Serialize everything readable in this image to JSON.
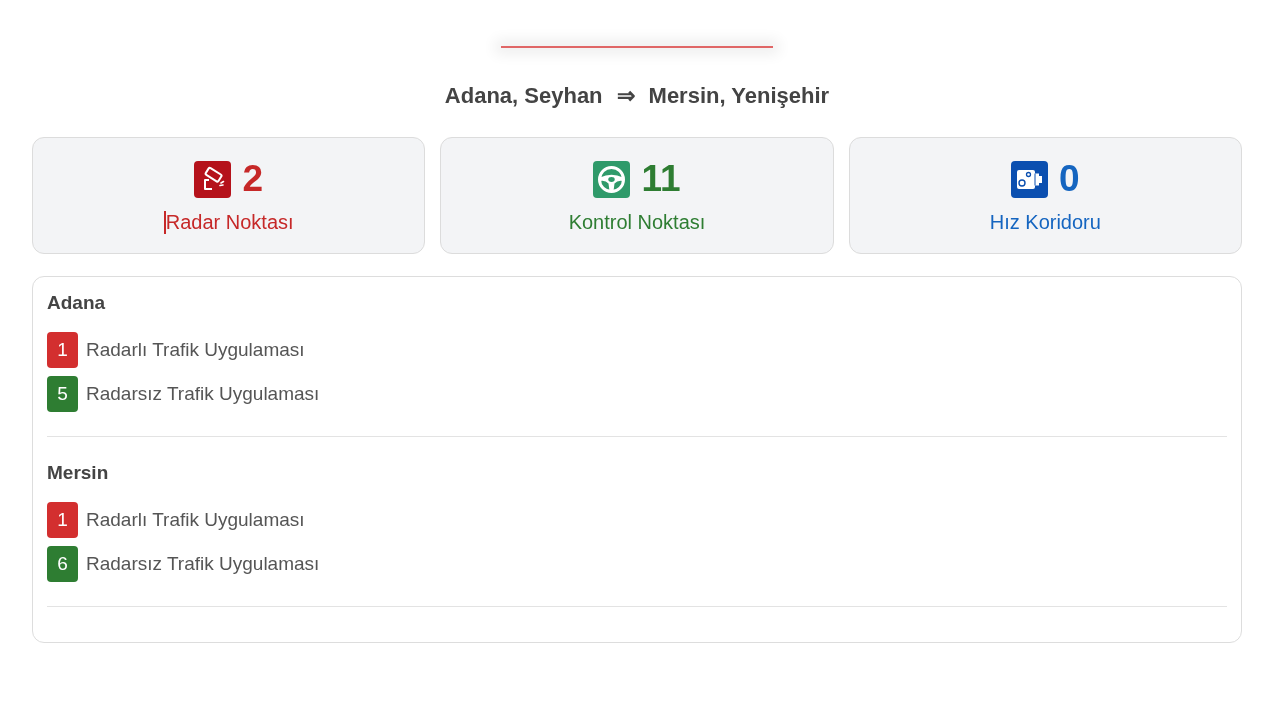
{
  "route": {
    "from": "Adana, Seyhan",
    "arrow": "⇒",
    "to": "Mersin, Yenişehir"
  },
  "stats": [
    {
      "kind": "radar",
      "count": "2",
      "label": "Radar Noktası",
      "color": "#c62828",
      "text_cursor": true
    },
    {
      "kind": "control",
      "count": "11",
      "label": "Kontrol Noktası",
      "color": "#2e7d32",
      "text_cursor": false
    },
    {
      "kind": "corridor",
      "count": "0",
      "label": "Hız Koridoru",
      "color": "#1565c0",
      "text_cursor": false
    }
  ],
  "cities": [
    {
      "name": "Adana",
      "items": [
        {
          "count": "1",
          "label": "Radarlı Trafik Uygulaması",
          "color": "#d32f2f"
        },
        {
          "count": "5",
          "label": "Radarsız Trafik Uygulaması",
          "color": "#2e7d32"
        }
      ]
    },
    {
      "name": "Mersin",
      "items": [
        {
          "count": "1",
          "label": "Radarlı Trafik Uygulaması",
          "color": "#d32f2f"
        },
        {
          "count": "6",
          "label": "Radarsız Trafik Uygulaması",
          "color": "#2e7d32"
        }
      ]
    }
  ]
}
